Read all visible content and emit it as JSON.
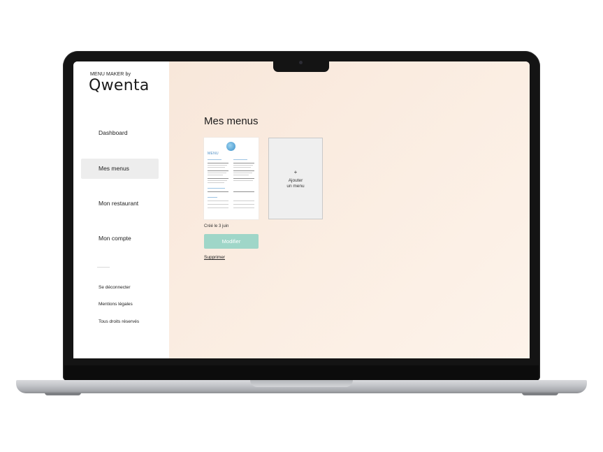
{
  "brand": {
    "tagline": "MENU MAKER by",
    "logo_text": "Qwenta"
  },
  "sidebar": {
    "items": [
      {
        "label": "Dashboard",
        "active": false
      },
      {
        "label": "Mes menus",
        "active": true
      },
      {
        "label": "Mon restaurant",
        "active": false
      },
      {
        "label": "Mon compte",
        "active": false
      }
    ],
    "footer_links": [
      "Se déconnecter",
      "Mentions légales",
      "Tous droits réservés"
    ]
  },
  "main": {
    "title": "Mes menus",
    "menu_card": {
      "heading": "MENU",
      "created": "Créé le 3 juin",
      "edit_label": "Modifier",
      "delete_label": "Supprimer"
    },
    "add_card": {
      "plus": "+",
      "label_line1": "Ajouter",
      "label_line2": "un menu"
    }
  },
  "colors": {
    "accent_button": "#9fd6c8",
    "active_nav_bg": "#ededed",
    "main_bg": "#fbeee3",
    "menu_heading": "#4f8fc4"
  }
}
